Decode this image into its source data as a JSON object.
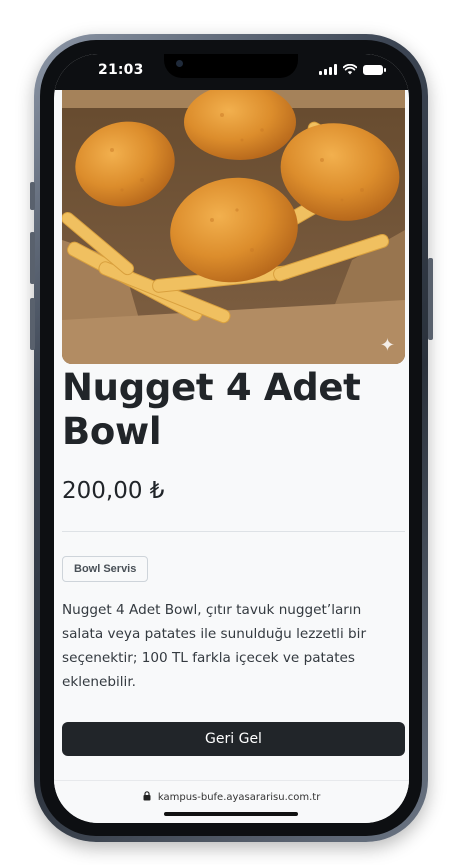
{
  "status_bar": {
    "time": "21:03"
  },
  "product": {
    "title": "Nugget 4 Adet Bowl",
    "price": "200,00 ₺",
    "category": "Bowl Servis",
    "description": "Nugget 4 Adet Bowl, çıtır tavuk nugget’ların salata veya patates ile sunulduğu lezzetli bir seçenektir; 100 TL farkla içecek ve patates eklenebilir.",
    "image_alt": "Nugget 4 Adet Bowl"
  },
  "actions": {
    "back_label": "Geri Gel"
  },
  "browser": {
    "url": "kampus-bufe.ayasararisu.com.tr"
  },
  "icons": {
    "lock": "lock-icon",
    "signal": "cellular-signal-icon",
    "wifi": "wifi-icon",
    "battery": "battery-icon",
    "sparkle": "sparkle-icon"
  },
  "colors": {
    "button_bg": "#212529",
    "page_bg": "#f8f9fa",
    "text": "#212529"
  }
}
